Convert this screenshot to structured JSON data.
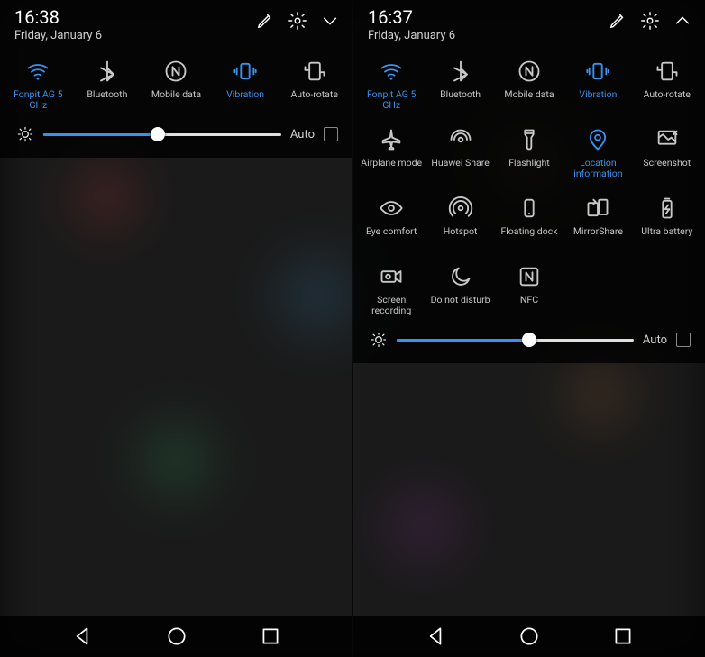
{
  "colors": {
    "accent": "#3a92f0",
    "muted": "#c8c8c8"
  },
  "left": {
    "time": "16:38",
    "date": "Friday, January 6",
    "expand_direction": "down",
    "tiles": [
      {
        "id": "wifi",
        "label": "Fonpit AG 5 GHz",
        "active": true
      },
      {
        "id": "bluetooth",
        "label": "Bluetooth",
        "active": false
      },
      {
        "id": "mobiledata",
        "label": "Mobile data",
        "active": false
      },
      {
        "id": "vibration",
        "label": "Vibration",
        "active": true
      },
      {
        "id": "autorotate",
        "label": "Auto-rotate",
        "active": false
      }
    ],
    "brightness": {
      "percent": 48,
      "auto_label": "Auto",
      "auto_checked": false
    }
  },
  "right": {
    "time": "16:37",
    "date": "Friday, January 6",
    "expand_direction": "up",
    "tiles": [
      {
        "id": "wifi",
        "label": "Fonpit AG 5 GHz",
        "active": true
      },
      {
        "id": "bluetooth",
        "label": "Bluetooth",
        "active": false
      },
      {
        "id": "mobiledata",
        "label": "Mobile data",
        "active": false
      },
      {
        "id": "vibration",
        "label": "Vibration",
        "active": true
      },
      {
        "id": "autorotate",
        "label": "Auto-rotate",
        "active": false
      },
      {
        "id": "airplane",
        "label": "Airplane mode",
        "active": false
      },
      {
        "id": "huaweishare",
        "label": "Huawei Share",
        "active": false
      },
      {
        "id": "flashlight",
        "label": "Flashlight",
        "active": false
      },
      {
        "id": "location",
        "label": "Location information",
        "active": true
      },
      {
        "id": "screenshot",
        "label": "Screenshot",
        "active": false
      },
      {
        "id": "eyecomfort",
        "label": "Eye comfort",
        "active": false
      },
      {
        "id": "hotspot",
        "label": "Hotspot",
        "active": false
      },
      {
        "id": "floatingdock",
        "label": "Floating dock",
        "active": false
      },
      {
        "id": "mirrorshare",
        "label": "MirrorShare",
        "active": false
      },
      {
        "id": "ultrabattery",
        "label": "Ultra battery",
        "active": false
      },
      {
        "id": "screenrec",
        "label": "Screen recording",
        "active": false
      },
      {
        "id": "dnd",
        "label": "Do not disturb",
        "active": false
      },
      {
        "id": "nfc",
        "label": "NFC",
        "active": false
      }
    ],
    "brightness": {
      "percent": 56,
      "auto_label": "Auto",
      "auto_checked": false
    }
  }
}
